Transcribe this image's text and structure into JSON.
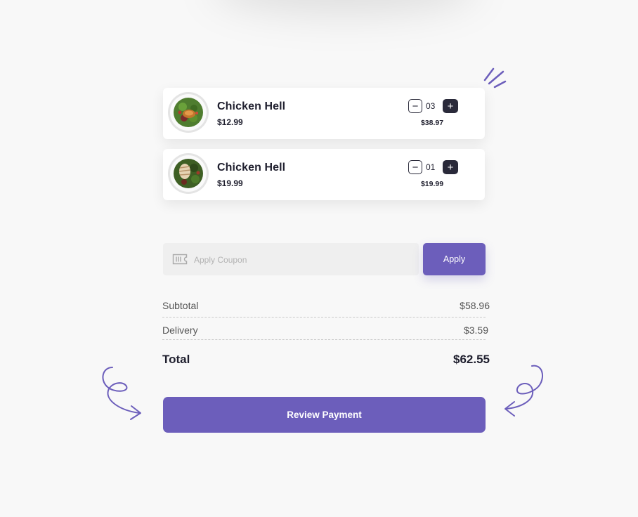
{
  "cart": {
    "items": [
      {
        "name": "Chicken Hell",
        "price": "$12.99",
        "quantity": "03",
        "line_total": "$38.97",
        "image": "salad-plate-grilled-chicken"
      },
      {
        "name": "Chicken Hell",
        "price": "$19.99",
        "quantity": "01",
        "line_total": "$19.99",
        "image": "salad-plate-sliced-chicken"
      }
    ],
    "controls": {
      "minus_symbol": "−",
      "plus_symbol": "+"
    }
  },
  "coupon": {
    "placeholder": "Apply Coupon",
    "value": "",
    "icon": "ticket-icon",
    "apply_label": "Apply"
  },
  "summary": {
    "subtotal_label": "Subtotal",
    "subtotal_value": "$58.96",
    "delivery_label": "Delivery",
    "delivery_value": "$3.59",
    "total_label": "Total",
    "total_value": "$62.55"
  },
  "actions": {
    "review_label": "Review Payment"
  },
  "colors": {
    "accent": "#6c5ebb",
    "dark": "#2a2a3a",
    "background": "#f8f8f8"
  }
}
